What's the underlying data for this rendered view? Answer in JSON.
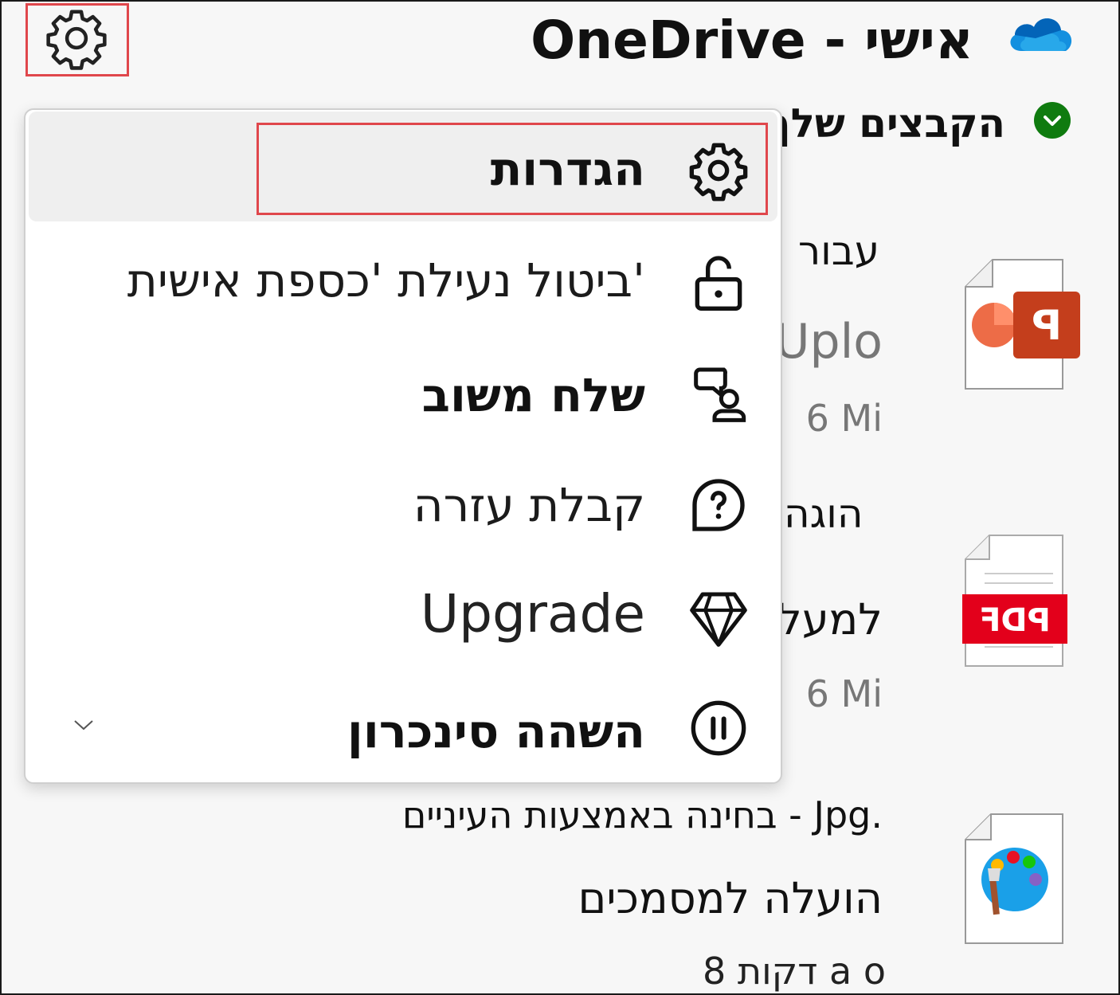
{
  "header": {
    "title": "OneDrive - אישי",
    "logo_icon": "onedrive-cloud-icon",
    "settings_icon": "gear-icon"
  },
  "files": {
    "section_title": "הקבצים שלך",
    "items": [
      {
        "icon": "powerpoint-file-icon",
        "title": "עבור",
        "detail": "Uplo",
        "time": "6 Mi"
      },
      {
        "icon": "pdf-file-icon",
        "title": "הוגה",
        "detail": "למעלה",
        "time": "6 Mi"
      },
      {
        "icon": "paint-file-icon",
        "title": "בחינה באמצעות העיניים - Jpg.",
        "detail": "הועלה למסמכים",
        "time": "8 דקות a o"
      }
    ]
  },
  "menu": {
    "items": [
      {
        "label": "הגדרות",
        "icon": "gear-icon"
      },
      {
        "label": "ביטול נעילת 'כספת אישית'",
        "icon": "unlock-icon"
      },
      {
        "label": "שלח משוב",
        "icon": "feedback-icon"
      },
      {
        "label": "קבלת עזרה",
        "icon": "help-icon"
      },
      {
        "label": "Upgrade",
        "icon": "diamond-icon"
      },
      {
        "label": "השהה סינכרון",
        "icon": "pause-icon"
      }
    ],
    "more_icon": "chevron-down-icon"
  },
  "colors": {
    "highlight_border": "#e0474c",
    "onedrive_blue": "#0f6cbd",
    "status_green": "#0f7b0f",
    "pdf_red": "#e3001b",
    "ppt_orange": "#c43e1c"
  }
}
